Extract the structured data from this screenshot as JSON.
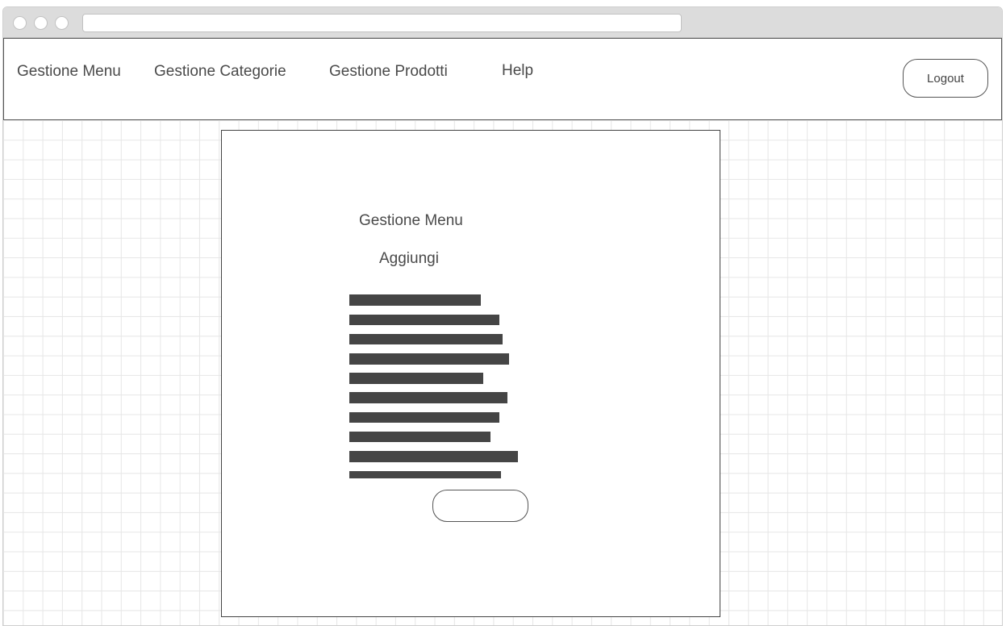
{
  "navbar": {
    "items": [
      {
        "label": "Gestione Menu"
      },
      {
        "label": "Gestione Categorie"
      },
      {
        "label": "Gestione Prodotti"
      },
      {
        "label": "Help"
      }
    ],
    "logout_label": "Logout"
  },
  "panel": {
    "title": "Gestione Menu",
    "add_label": "Aggiungi",
    "button_label": ""
  },
  "colors": {
    "titlebar": "#dcdcdc",
    "border": "#555555",
    "text_bars": "#454545",
    "grid_lines": "#e6e6e6"
  }
}
